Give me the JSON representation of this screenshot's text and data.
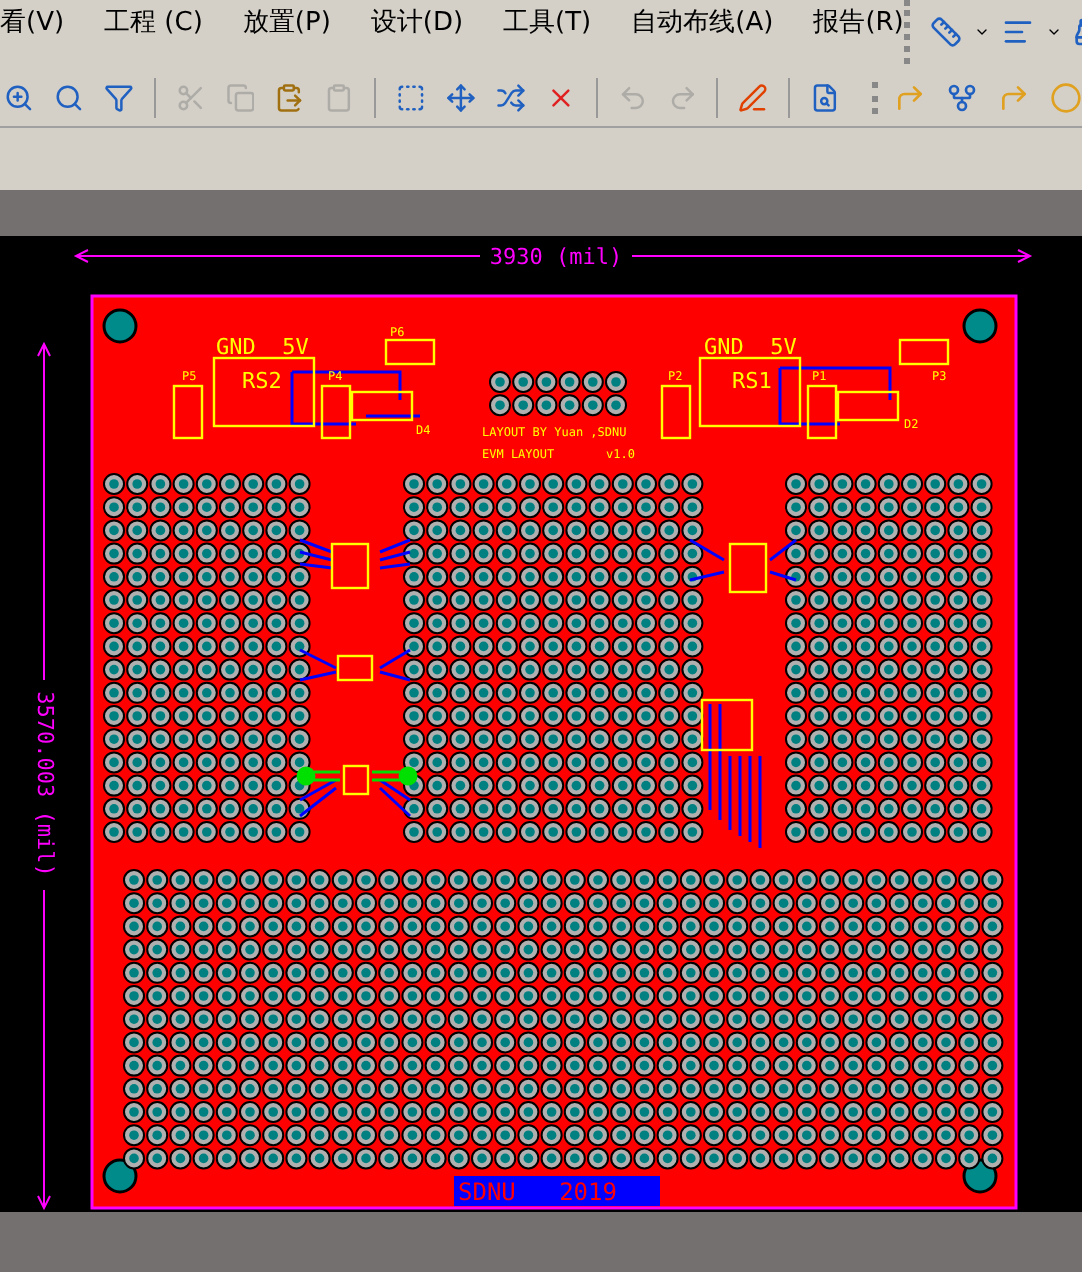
{
  "menu": [
    "看(V)",
    "工程 (C)",
    "放置(P)",
    "设计(D)",
    "工具(T)",
    "自动布线(A)",
    "报告(R)"
  ],
  "board": {
    "width_dimension": "3930 (mil)",
    "height_dimension": "3570.003 (mil)",
    "silkscreen": [
      {
        "text": "GND  5V",
        "kind": "label"
      },
      {
        "text": "P6",
        "kind": "ref"
      },
      {
        "text": "GND  5V",
        "kind": "label"
      },
      {
        "text": "P5",
        "kind": "ref"
      },
      {
        "text": "RS2",
        "kind": "label"
      },
      {
        "text": "P4",
        "kind": "ref"
      },
      {
        "text": "P2",
        "kind": "ref"
      },
      {
        "text": "RS1",
        "kind": "label"
      },
      {
        "text": "P1",
        "kind": "ref"
      },
      {
        "text": "P3",
        "kind": "ref"
      },
      {
        "text": "D2",
        "kind": "ref"
      },
      {
        "text": "D4",
        "kind": "ref"
      },
      {
        "text": "LAYOUT BY Yuan ,SDNU",
        "kind": "ref"
      },
      {
        "text": "EVM LAYOUT",
        "kind": "ref"
      },
      {
        "text": "v1.0",
        "kind": "ref"
      }
    ],
    "footer_label": "SDNU   2019"
  }
}
